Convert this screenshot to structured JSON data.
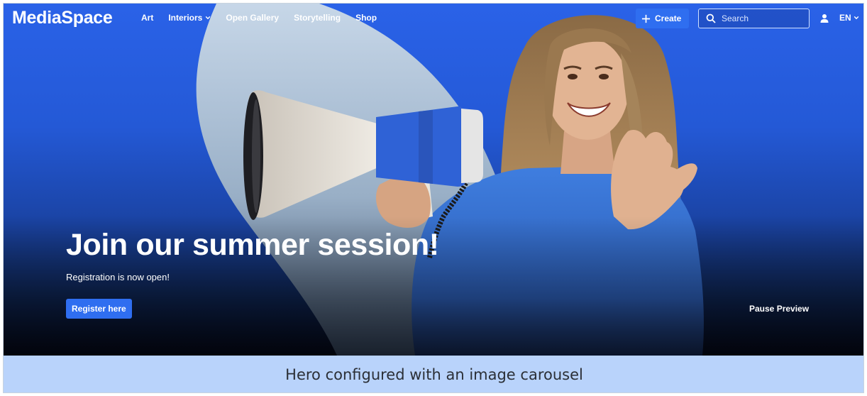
{
  "header": {
    "logo": "MediaSpace",
    "nav": [
      {
        "label": "Art",
        "has_dropdown": false
      },
      {
        "label": "Interiors",
        "has_dropdown": true
      },
      {
        "label": "Open Gallery",
        "has_dropdown": false
      },
      {
        "label": "Storytelling",
        "has_dropdown": false
      },
      {
        "label": "Shop",
        "has_dropdown": false
      }
    ],
    "create_label": "Create",
    "search_placeholder": "Search",
    "user_icon": "user-icon",
    "language": "EN"
  },
  "hero": {
    "headline": "Join our summer session!",
    "subtext": "Registration is now open!",
    "register_label": "Register here",
    "pause_label": "Pause Preview",
    "image_description_icon": "woman-with-megaphone-image"
  },
  "caption": "Hero configured with an image carousel",
  "colors": {
    "hero_blue": "#2a62e8",
    "button_blue": "#2f6ef0",
    "caption_bg": "#b9d3fb",
    "hero_dark": "#05091a"
  }
}
